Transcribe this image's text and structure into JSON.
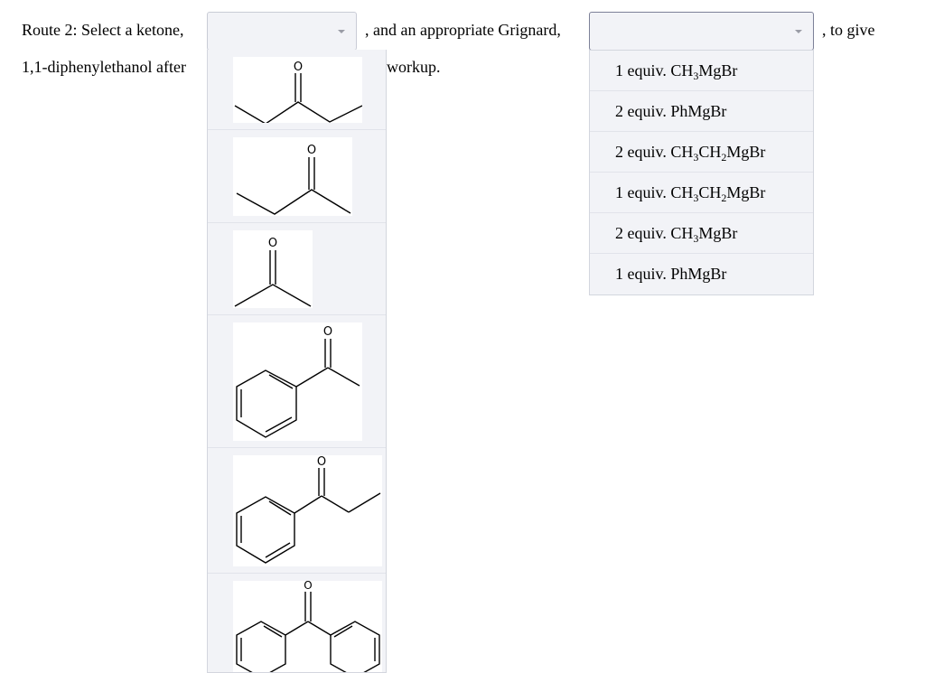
{
  "question": {
    "part1": "Route 2: Select a ketone,",
    "part2": ", and an appropriate Grignard,",
    "part3": ", to give",
    "line2_left": "1,1-diphenylethanol after",
    "line2_right": "workup."
  },
  "ketone_select": {
    "value": "",
    "caret_icon": "chevron-down-icon",
    "options": [
      {
        "depicts": "3-pentanone",
        "atom_label": "O"
      },
      {
        "depicts": "2-butanone",
        "atom_label": "O"
      },
      {
        "depicts": "acetone",
        "atom_label": "O"
      },
      {
        "depicts": "acetophenone",
        "atom_label": "O"
      },
      {
        "depicts": "propiophenone",
        "atom_label": "O"
      },
      {
        "depicts": "benzophenone",
        "atom_label": "O"
      }
    ]
  },
  "grignard_select": {
    "value": "",
    "caret_icon": "chevron-down-icon",
    "options": [
      {
        "amount": "1 equiv.",
        "formula": [
          [
            "CH",
            "3"
          ],
          [
            "MgBr",
            ""
          ]
        ]
      },
      {
        "amount": "2 equiv.",
        "formula": [
          [
            "PhMgBr",
            ""
          ]
        ]
      },
      {
        "amount": "2 equiv.",
        "formula": [
          [
            "CH",
            "3"
          ],
          [
            "CH",
            "2"
          ],
          [
            "MgBr",
            ""
          ]
        ]
      },
      {
        "amount": "1 equiv.",
        "formula": [
          [
            "CH",
            "3"
          ],
          [
            "CH",
            "2"
          ],
          [
            "MgBr",
            ""
          ]
        ]
      },
      {
        "amount": "2 equiv.",
        "formula": [
          [
            "CH",
            "3"
          ],
          [
            "MgBr",
            ""
          ]
        ]
      },
      {
        "amount": "1 equiv.",
        "formula": [
          [
            "PhMgBr",
            ""
          ]
        ]
      }
    ]
  }
}
